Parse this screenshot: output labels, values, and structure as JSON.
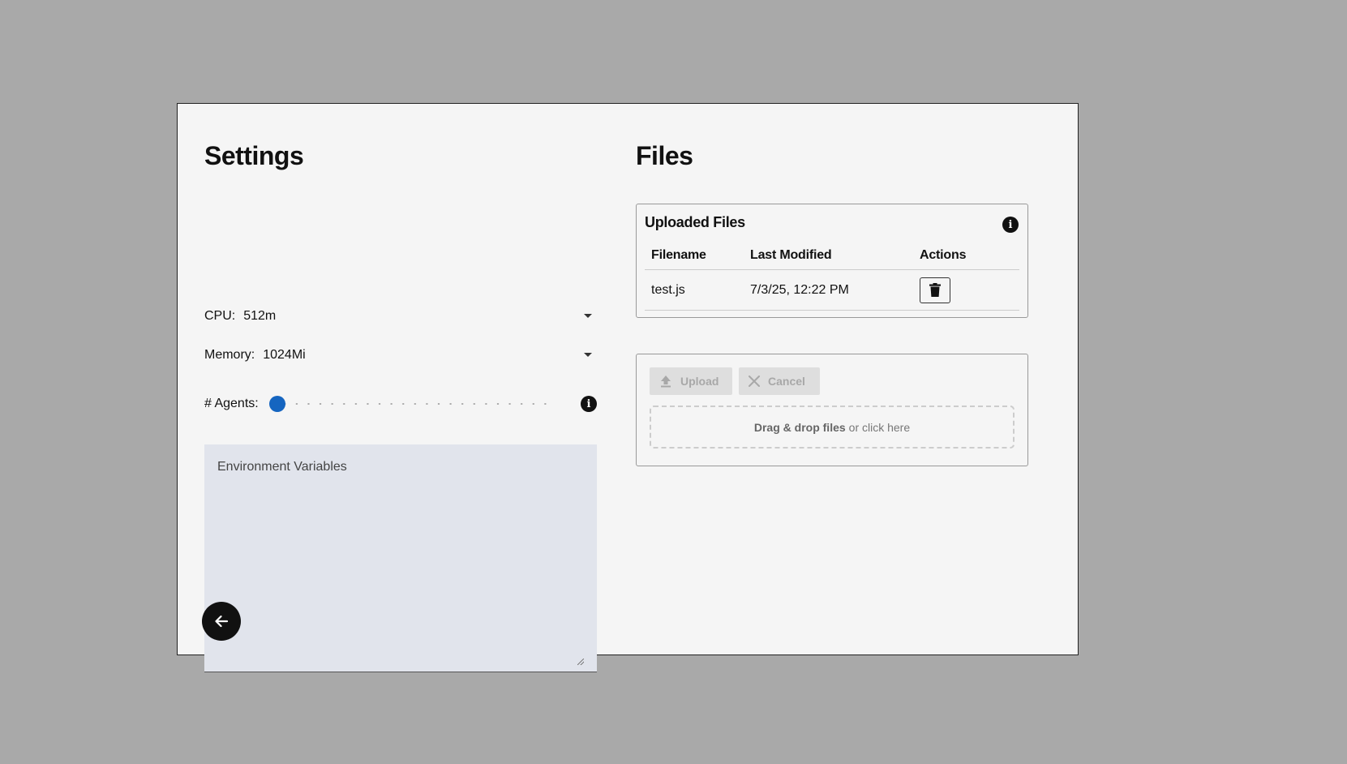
{
  "settings": {
    "title": "Settings",
    "cpu": {
      "label": "CPU:",
      "value": "512m"
    },
    "memory": {
      "label": "Memory:",
      "value": "1024Mi"
    },
    "agents": {
      "label": "# Agents:",
      "value_fraction": 0.0
    },
    "env_placeholder": "Environment Variables"
  },
  "files": {
    "title": "Files",
    "panel_title": "Uploaded Files",
    "columns": [
      "Filename",
      "Last Modified",
      "Actions"
    ],
    "rows": [
      {
        "filename": "test.js",
        "modified": "7/3/25, 12:22 PM"
      }
    ],
    "upload_label": "Upload",
    "cancel_label": "Cancel",
    "drop_bold": "Drag & drop files",
    "drop_rest": "or click here"
  },
  "icons": {
    "info": "info-icon",
    "back": "arrow-left-icon",
    "delete": "trash-icon",
    "upload": "upload-icon",
    "cancel": "close-icon"
  },
  "colors": {
    "slider_thumb": "#1565c0",
    "backdrop": "#a9a9a9",
    "env_bg": "#e1e4ec"
  }
}
